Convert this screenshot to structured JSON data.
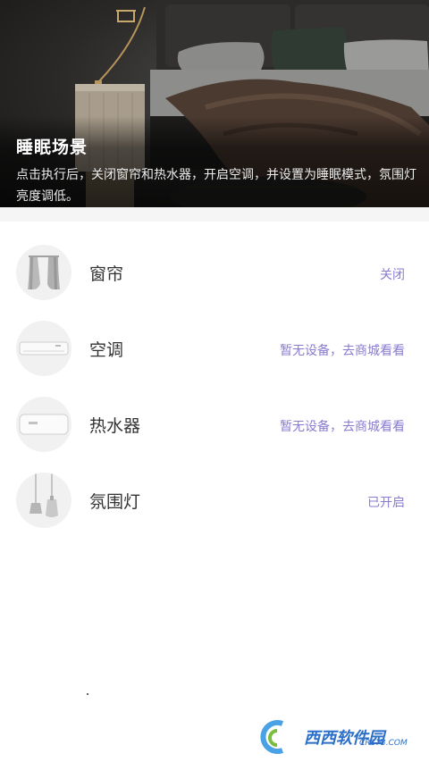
{
  "hero": {
    "title": "睡眠场景",
    "description": "点击执行后，关闭窗帘和热水器，开启空调，并设置为睡眠模式，氛围灯亮度调低。"
  },
  "devices": [
    {
      "name": "窗帘",
      "status": "关闭",
      "icon": "curtain-icon"
    },
    {
      "name": "空调",
      "status": "暂无设备，去商城看看",
      "icon": "air-conditioner-icon"
    },
    {
      "name": "热水器",
      "status": "暂无设备，去商城看看",
      "icon": "water-heater-icon"
    },
    {
      "name": "氛围灯",
      "status": "已开启",
      "icon": "pendant-lamp-icon"
    }
  ],
  "watermark": {
    "brand": "西西软件园",
    "url": "CR173.COM"
  },
  "colors": {
    "status": "#8a7bd0",
    "name": "#333333",
    "thumb_bg": "#f1f1f1",
    "band": "#f5f5f5"
  }
}
